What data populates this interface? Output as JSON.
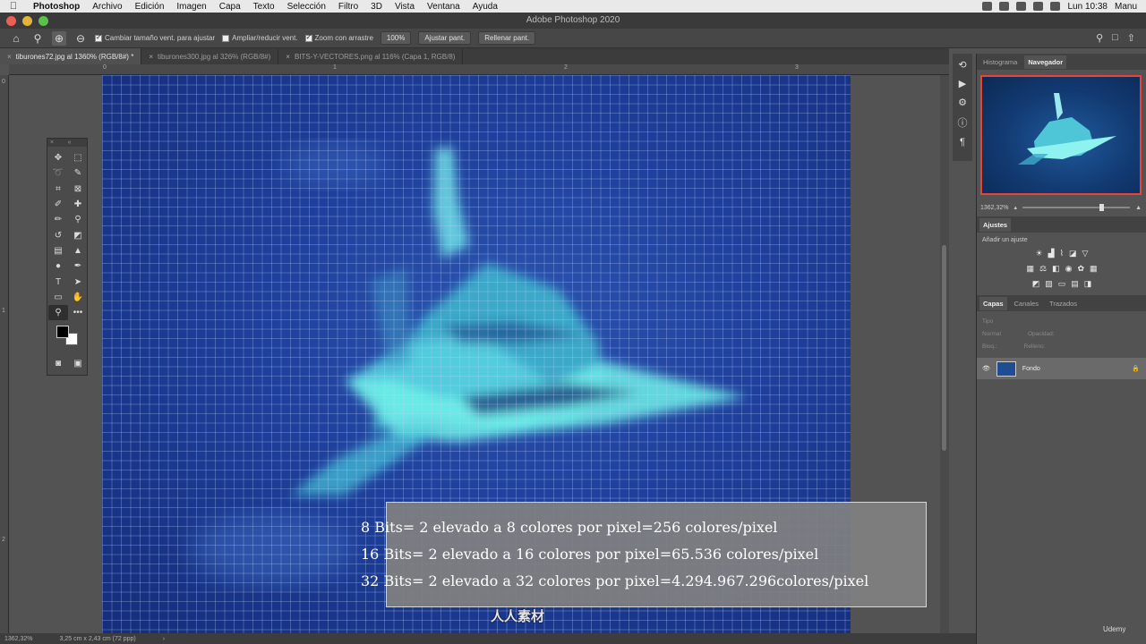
{
  "menubar": {
    "apple": "",
    "app": "Photoshop",
    "items": [
      "Archivo",
      "Edición",
      "Imagen",
      "Capa",
      "Texto",
      "Selección",
      "Filtro",
      "3D",
      "Vista",
      "Ventana",
      "Ayuda"
    ],
    "clock": "Lun 10:38",
    "user": "Manu"
  },
  "window": {
    "title": "Adobe Photoshop 2020"
  },
  "options": {
    "resize_windows": "Cambiar tamaño vent. para ajustar",
    "zoom_all": "Ampliar/reducir vent.",
    "scrubby_zoom": "Zoom con arrastre",
    "zoom_value": "100%",
    "fit_screen": "Ajustar pant.",
    "fill_screen": "Rellenar pant."
  },
  "tabs": [
    {
      "label": "tiburones72.jpg al 1360% (RGB/8#) *"
    },
    {
      "label": "tiburones300.jpg al 326% (RGB/8#)"
    },
    {
      "label": "BITS-Y-VECTORES.png al 116% (Capa 1, RGB/8)"
    }
  ],
  "rulers": {
    "top": [
      "0",
      "1",
      "2",
      "3"
    ],
    "left": [
      "0",
      "1",
      "2"
    ]
  },
  "overlay": {
    "lines": [
      "8 Bits= 2 elevado a 8 colores por pixel=256 colores/pixel",
      "16 Bits= 2 elevado a 16 colores por pixel=65.536 colores/pixel",
      "32 Bits= 2 elevado a 32 colores por pixel=4.294.967.296colores/pixel"
    ]
  },
  "status": {
    "zoom": "1362,32%",
    "size": "3,25 cm x 2,43 cm (72 ppp)",
    "arrow": "›"
  },
  "panels": {
    "nav_tabs": [
      "Histograma",
      "Navegador"
    ],
    "nav_zoom": "1362,32%",
    "adjustments_title": "Ajustes",
    "adjustments_sub": "Añadir un ajuste",
    "layer_tabs": [
      "Capas",
      "Canales",
      "Trazados"
    ],
    "layer_kind": "Tipo",
    "blend_mode": "Normal",
    "opacity_label": "Opacidad:",
    "lock_label": "Bloq.:",
    "fill_label": "Relleno:",
    "layer_name": "Fondo"
  },
  "watermark": {
    "logo": "人人素材",
    "udemy": "Udemy"
  },
  "colors": {
    "canvas": "#1e3f9b",
    "grid": "#bed2ff",
    "shark": "#5fe4e6",
    "nav_border": "#e8443a"
  }
}
